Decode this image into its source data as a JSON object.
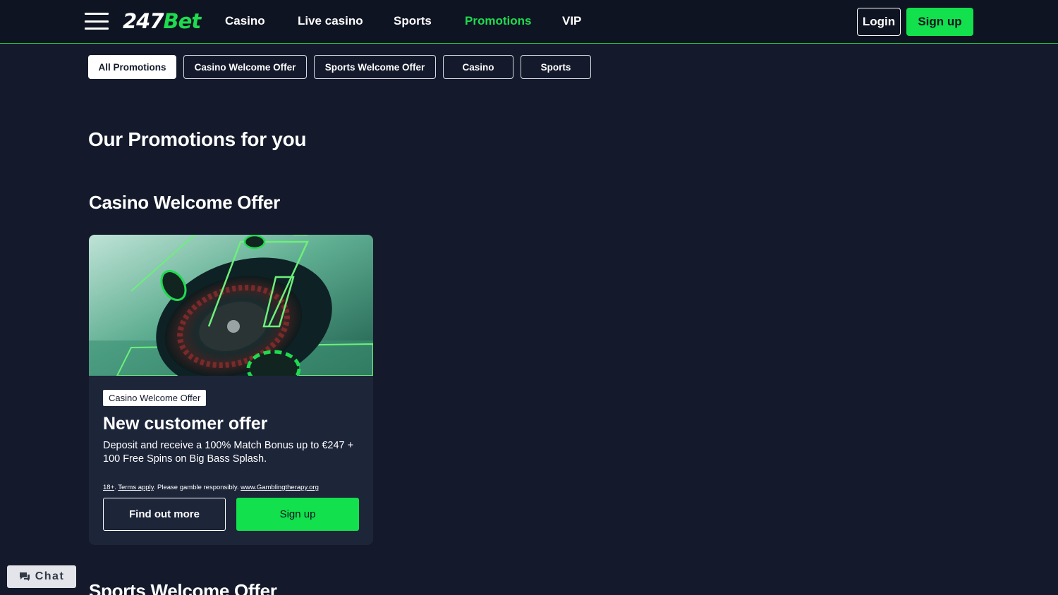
{
  "header": {
    "logo_number": "247",
    "logo_word": "Bet",
    "nav": [
      {
        "label": "Casino"
      },
      {
        "label": "Live casino"
      },
      {
        "label": "Sports"
      },
      {
        "label": "Promotions",
        "active": true
      },
      {
        "label": "VIP"
      }
    ],
    "login_label": "Login",
    "signup_label": "Sign up"
  },
  "filters": [
    {
      "label": "All Promotions",
      "active": true
    },
    {
      "label": "Casino Welcome Offer"
    },
    {
      "label": "Sports Welcome Offer"
    },
    {
      "label": "Casino"
    },
    {
      "label": "Sports"
    }
  ],
  "main": {
    "page_title": "Our Promotions for you",
    "sections": [
      {
        "title": "Casino Welcome Offer",
        "cards": [
          {
            "tag": "Casino Welcome Offer",
            "title": "New customer offer",
            "description": "Deposit and receive a 100% Match Bonus up to €247 + 100 Free Spins on Big Bass Splash.",
            "legal_age": "18+",
            "legal_sep1": ".",
            "legal_terms": "Terms apply",
            "legal_text": ". Please gamble responsibly.",
            "legal_link": "www.Gamblingtherapy.org",
            "find_out_label": "Find out more",
            "signup_label": "Sign up"
          }
        ]
      },
      {
        "title": "Sports Welcome Offer"
      }
    ]
  },
  "chat": {
    "label": "Chat",
    "icon": "chat-bubble-icon"
  },
  "colors": {
    "background": "#141a2b",
    "header": "#0f1422",
    "accent_green": "#12e04c",
    "card": "#1d2539"
  }
}
